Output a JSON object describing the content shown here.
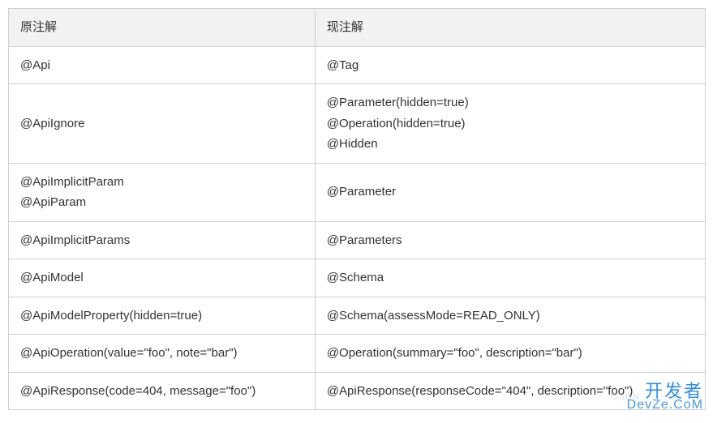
{
  "table": {
    "headers": [
      "原注解",
      "现注解"
    ],
    "rows": [
      {
        "old": [
          "@Api"
        ],
        "new": [
          "@Tag"
        ]
      },
      {
        "old": [
          "@ApiIgnore"
        ],
        "new": [
          "@Parameter(hidden=true)",
          "@Operation(hidden=true)",
          "@Hidden"
        ]
      },
      {
        "old": [
          "@ApiImplicitParam",
          "@ApiParam"
        ],
        "new": [
          "@Parameter"
        ]
      },
      {
        "old": [
          "@ApiImplicitParams"
        ],
        "new": [
          "@Parameters"
        ]
      },
      {
        "old": [
          "@ApiModel"
        ],
        "new": [
          "@Schema"
        ]
      },
      {
        "old": [
          "@ApiModelProperty(hidden=true)"
        ],
        "new": [
          "@Schema(assessMode=READ_ONLY)"
        ]
      },
      {
        "old": [
          "@ApiOperation(value=\"foo\", note=\"bar\")"
        ],
        "new": [
          "@Operation(summary=\"foo\", description=\"bar\")"
        ]
      },
      {
        "old": [
          "@ApiResponse(code=404, message=\"foo\")"
        ],
        "new": [
          "@ApiResponse(responseCode=\"404\", description=\"foo\")"
        ]
      }
    ]
  },
  "watermark": {
    "top": "开发者",
    "bottom": "DevZe.CoM",
    "faint": "CSDN"
  }
}
